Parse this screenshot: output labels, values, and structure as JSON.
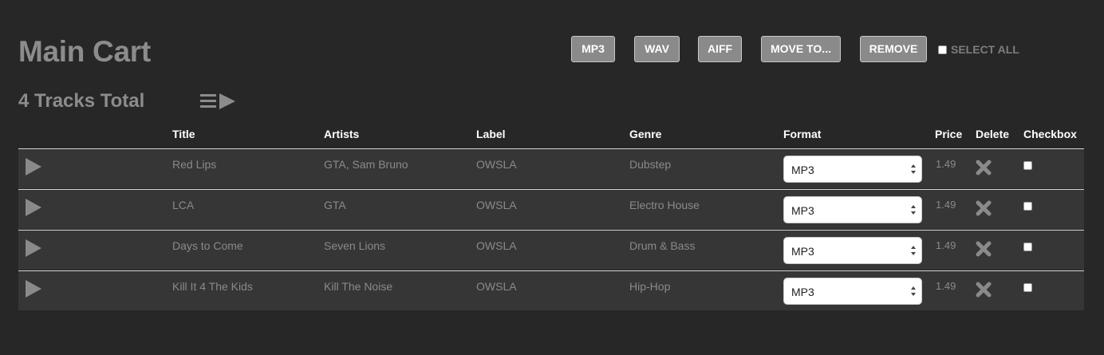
{
  "cart": {
    "title": "Main Cart",
    "total": "4 Tracks Total"
  },
  "toolbar": {
    "mp3_label": "MP3",
    "wav_label": "WAV",
    "aiff_label": "AIFF",
    "move_label": "MOVE TO...",
    "remove_label": "REMOVE",
    "select_all_label": "SELECT ALL"
  },
  "columns": {
    "title": "Title",
    "artists": "Artists",
    "label": "Label",
    "genre": "Genre",
    "format": "Format",
    "price": "Price",
    "delete": "Delete",
    "checkbox": "Checkbox"
  },
  "tracks": [
    {
      "title": "Red Lips",
      "artists": "GTA, Sam Bruno",
      "label": "OWSLA",
      "genre": "Dubstep",
      "format": "MP3",
      "price": "1.49",
      "checked": false
    },
    {
      "title": "LCA",
      "artists": "GTA",
      "label": "OWSLA",
      "genre": "Electro House",
      "format": "MP3",
      "price": "1.49",
      "checked": false
    },
    {
      "title": "Days to Come",
      "artists": "Seven Lions",
      "label": "OWSLA",
      "genre": "Drum & Bass",
      "format": "MP3",
      "price": "1.49",
      "checked": false
    },
    {
      "title": "Kill It 4 The Kids",
      "artists": "Kill The Noise",
      "label": "OWSLA",
      "genre": "Hip-Hop",
      "format": "MP3",
      "price": "1.49",
      "checked": false
    }
  ],
  "icons": {
    "play": "play-icon",
    "delete": "close-icon",
    "playlist": "playlist-play-icon",
    "select_arrows": "updown-arrows-icon"
  },
  "colors": {
    "background": "#272727",
    "row_background": "#363636",
    "button_background": "#8a8a8a",
    "muted_text": "#8a8a8a"
  }
}
